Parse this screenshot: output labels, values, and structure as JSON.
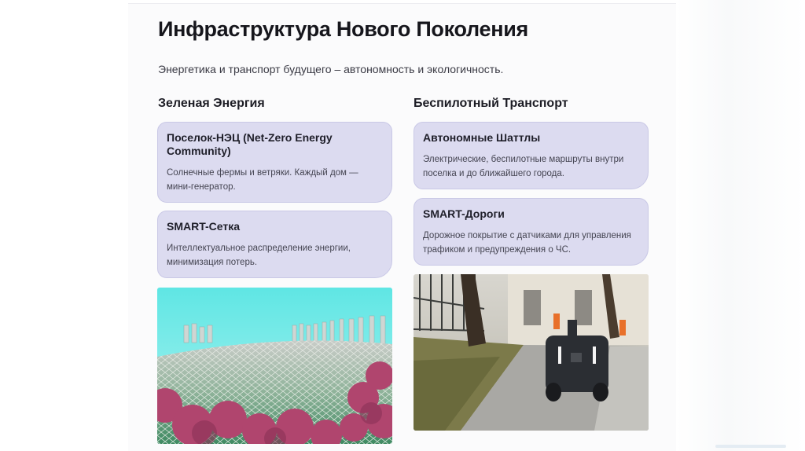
{
  "header": {
    "title": "Инфраструктура Нового Поколения",
    "subtitle": "Энергетика и транспорт будущего – автономность и экологичность."
  },
  "columns": [
    {
      "heading": "Зеленая Энергия",
      "cards": [
        {
          "title": "Поселок-НЭЦ (Net-Zero Energy Community)",
          "text": "Солнечные фермы и ветряки. Каждый дом — мини-генератор."
        },
        {
          "title": "SMART-Сетка",
          "text": "Интеллектуальное распределение энергии, минимизация потерь."
        }
      ],
      "image": "eco-building-photo"
    },
    {
      "heading": "Беспилотный Транспорт",
      "cards": [
        {
          "title": "Автономные Шаттлы",
          "text": "Электрические, беспилотные маршруты внутри поселка и до ближайшего города."
        },
        {
          "title": "SMART-Дороги",
          "text": "Дорожное покрытие с датчиками для управления трафиком и предупреждения о ЧС."
        }
      ],
      "image": "delivery-robot-photo"
    }
  ],
  "colors": {
    "card_bg": "#dcdbf0",
    "card_border": "#c9c8e6",
    "title": "#16161c"
  }
}
